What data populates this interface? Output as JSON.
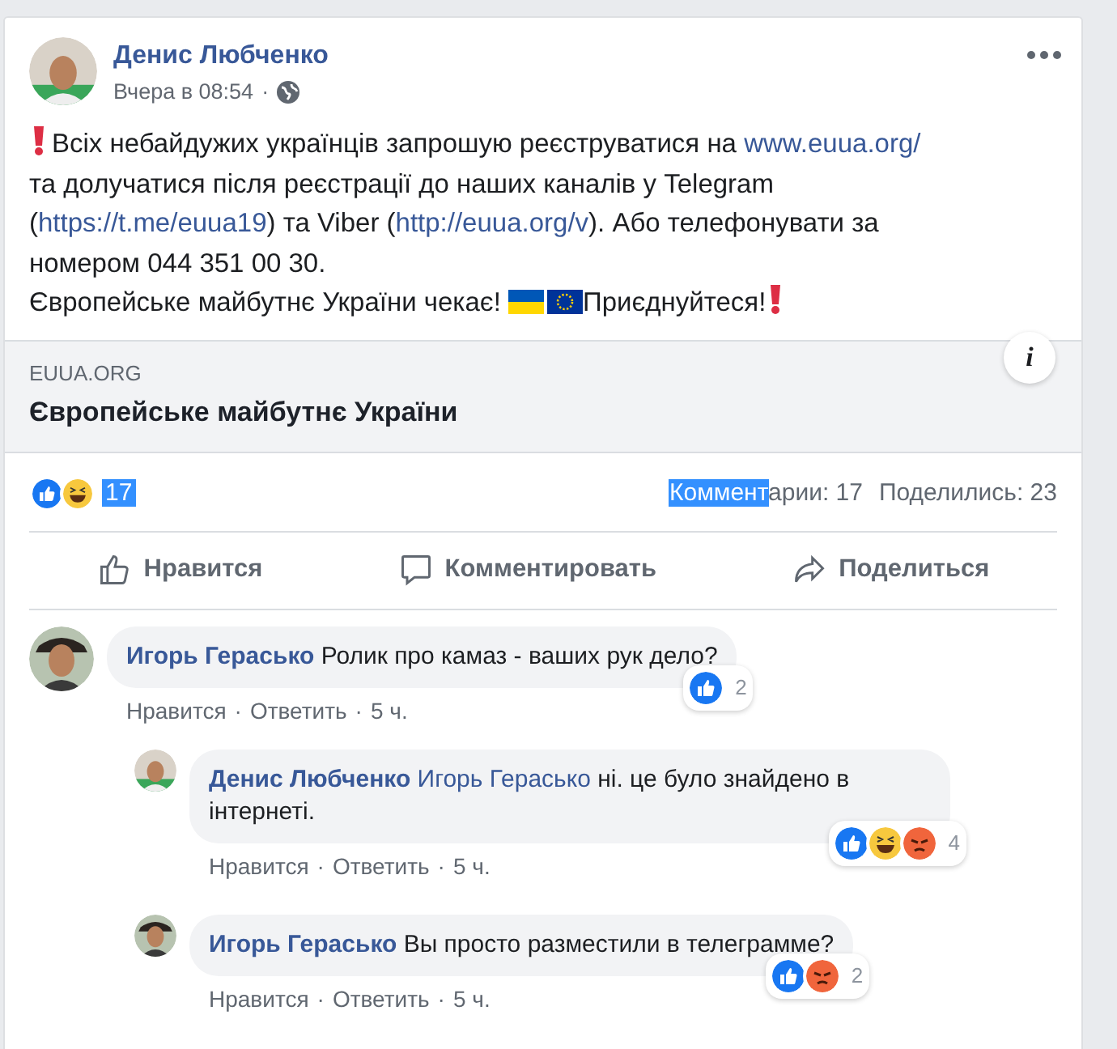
{
  "post": {
    "author": "Денис Любченко",
    "time": "Вчера в 08:54",
    "separator": "·",
    "message": [
      [
        {
          "kind": "exclamation"
        },
        {
          "kind": "text",
          "text": "Всіх небайдужих українців запрошую реєструватися на "
        },
        {
          "kind": "link",
          "text": "www.euua.org/"
        }
      ],
      [
        {
          "kind": "text",
          "text": "та долучатися після реєстрації до наших каналів у Telegram"
        }
      ],
      [
        {
          "kind": "text",
          "text": "("
        },
        {
          "kind": "link",
          "text": "https://t.me/euua19"
        },
        {
          "kind": "text",
          "text": ") та Viber ("
        },
        {
          "kind": "link",
          "text": "http://euua.org/v"
        },
        {
          "kind": "text",
          "text": "). Або телефонувати за"
        }
      ],
      [
        {
          "kind": "text",
          "text": "номером 044 351 00 30."
        }
      ],
      [
        {
          "kind": "text",
          "text": "Європейське майбутнє України чекає! "
        },
        {
          "kind": "flag_ua"
        },
        {
          "kind": "flag_eu"
        },
        {
          "kind": "text",
          "text": "Приєднуйтеся!"
        },
        {
          "kind": "exclamation"
        }
      ]
    ],
    "link_preview": {
      "domain": "EUUA.ORG",
      "title": "Європейське майбутнє України",
      "info": "i"
    },
    "reactions": [
      {
        "kind": "like"
      },
      {
        "kind": "haha"
      }
    ],
    "reaction_count": {
      "text": "17",
      "selected": true
    },
    "comments_count": {
      "selected_part": "Коммент",
      "rest": "арии: 17"
    },
    "shares": "Поделились: 23",
    "actions": [
      {
        "kind": "like",
        "label": "Нравится"
      },
      {
        "kind": "comment",
        "label": "Комментировать"
      },
      {
        "kind": "share",
        "label": "Поделиться"
      }
    ]
  },
  "comments": [
    {
      "author": "Игорь Герасько",
      "text": "Ролик про камаз - ваших рук дело?",
      "like": "Нравится",
      "reply": "Ответить",
      "time": "5 ч.",
      "reactions": [
        {
          "kind": "like"
        }
      ],
      "count": "2",
      "replies": [
        {
          "author": "Денис Любченко",
          "mention": "Игорь Герасько",
          "text": "ні. це було знайдено в інтернеті.",
          "like": "Нравится",
          "reply": "Ответить",
          "time": "5 ч.",
          "reactions": [
            {
              "kind": "like"
            },
            {
              "kind": "haha"
            },
            {
              "kind": "angry"
            }
          ],
          "count": "4"
        },
        {
          "author": "Игорь Герасько",
          "text": "Вы просто разместили в телеграмме?",
          "like": "Нравится",
          "reply": "Ответить",
          "time": "5 ч.",
          "reactions": [
            {
              "kind": "like"
            },
            {
              "kind": "angry"
            }
          ],
          "count": "2"
        }
      ]
    }
  ]
}
